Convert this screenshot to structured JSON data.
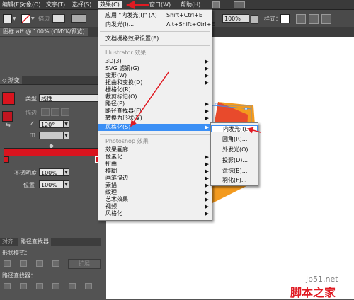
{
  "menubar": {
    "items": [
      "编辑(E)",
      "对象(O)",
      "文字(T)",
      "选择(S)",
      "效果(C)",
      "窗口(W)",
      "帮助(H)"
    ]
  },
  "control_bar": {
    "stroke_label": "描边",
    "opacity_value": "100%",
    "style_label": "样式："
  },
  "document_tab": {
    "title": "图标.ai* @ 100% (CMYK/预览)"
  },
  "gradient_panel": {
    "title": "渐变",
    "type_label": "类型",
    "type_value": "线性",
    "stroke_label": "描边",
    "angle_value": "120°",
    "opacity_label": "不透明度",
    "opacity_value": "100%",
    "location_label": "位置",
    "location_value": "100%",
    "fill_color": "#d9141e"
  },
  "pathfinder_panel": {
    "tabs": [
      "对齐",
      "路径查找器"
    ],
    "shape_modes_label": "形状模式：",
    "expand_label": "扩展",
    "pathfinders_label": "路径查找器："
  },
  "effect_menu": {
    "top_items": [
      {
        "label": "应用 \"内发光(I)\" (A)",
        "shortcut": "Shift+Ctrl+E"
      },
      {
        "label": "内发光(I)...",
        "shortcut": "Alt+Shift+Ctrl+E"
      }
    ],
    "document_raster_settings": "文档栅格效果设置(E)...",
    "illustrator_section": "Illustrator 效果",
    "illustrator_items": [
      "3D(3)",
      "SVG 滤镜(G)",
      "变形(W)",
      "扭曲和变换(D)",
      "栅格化(R)...",
      "裁剪标记(O)",
      "路径(P)",
      "路径查找器(F)",
      "转换为形状(V)",
      "风格化(S)"
    ],
    "photoshop_section": "Photoshop 效果",
    "photoshop_items": [
      "效果画廊...",
      "像素化",
      "扭曲",
      "模糊",
      "画笔描边",
      "素描",
      "纹理",
      "艺术效果",
      "视频",
      "风格化"
    ]
  },
  "stylize_submenu": {
    "items": [
      "内发光(I)...",
      "圆角(R)...",
      "外发光(O)...",
      "投影(D)...",
      "涂抹(B)...",
      "羽化(F)..."
    ]
  },
  "watermark": {
    "site": "jb51.net",
    "brand": "脚本之家"
  },
  "colors": {
    "accent_red": "#e01b23",
    "highlight_blue": "#3b8ff5",
    "logo_orange": "#f39a1e"
  }
}
